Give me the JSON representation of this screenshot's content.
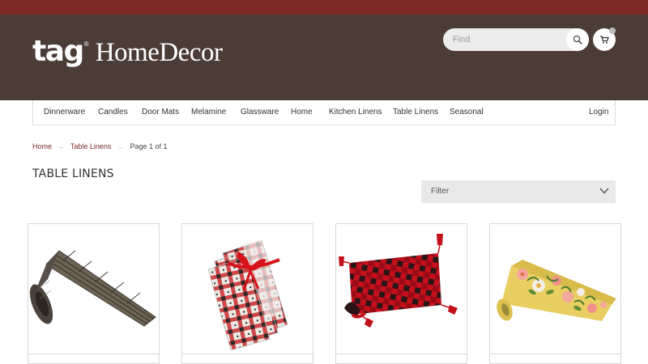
{
  "brand": {
    "mark": "tag",
    "registered": "®",
    "name": "HomeDecor"
  },
  "header": {
    "search_placeholder": "Find"
  },
  "nav": [
    "Dinnerware",
    "Candles",
    "Door Mats",
    "Melamine",
    "Glassware",
    "Home",
    "Kitchen Linens",
    "Table Linens",
    "Seasonal"
  ],
  "login_label": "Login",
  "breadcrumb": {
    "home": "Home",
    "category": "Table Linens",
    "page": "Page 1 of 1",
    "separator": "→"
  },
  "page_title": "TABLE LINENS",
  "filter_label": "Filter",
  "products": [
    {
      "image": "dark-woven-table-runner"
    },
    {
      "image": "plaid-napkin-bundle-red-bow"
    },
    {
      "image": "buffalo-check-runner-tassels"
    },
    {
      "image": "yellow-floral-table-runner"
    }
  ],
  "colors": {
    "topbar": "#7e2a29",
    "header": "#4c3c36",
    "link": "#7e2a29"
  }
}
